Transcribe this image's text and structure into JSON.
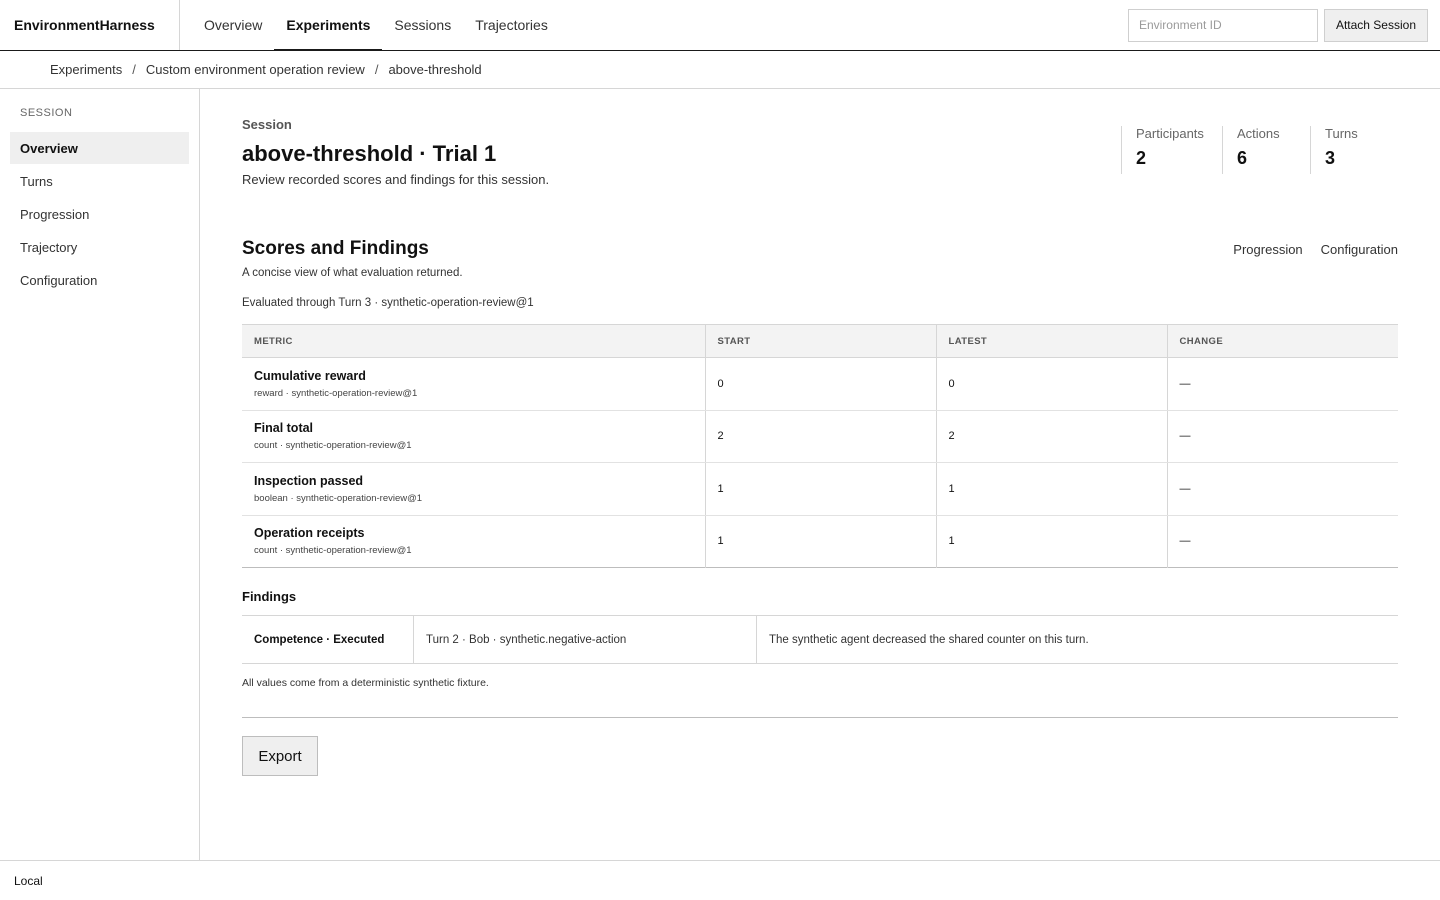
{
  "app": {
    "brand": "EnvironmentHarness"
  },
  "topnav": {
    "items": [
      {
        "label": "Overview"
      },
      {
        "label": "Experiments",
        "active": true
      },
      {
        "label": "Sessions"
      },
      {
        "label": "Trajectories"
      }
    ],
    "environment_placeholder": "Environment ID",
    "attach_label": "Attach Session"
  },
  "breadcrumb": {
    "items": [
      "Experiments",
      "Custom environment operation review",
      "above-threshold"
    ],
    "separator": "/"
  },
  "sidebar": {
    "heading": "SESSION",
    "items": [
      {
        "label": "Overview",
        "active": true
      },
      {
        "label": "Turns"
      },
      {
        "label": "Progression"
      },
      {
        "label": "Trajectory"
      },
      {
        "label": "Configuration"
      }
    ]
  },
  "session": {
    "label": "Session",
    "title": "above-threshold · Trial 1",
    "description": "Review recorded scores and findings for this session.",
    "stats": [
      {
        "label": "Participants",
        "value": "2"
      },
      {
        "label": "Actions",
        "value": "6"
      },
      {
        "label": "Turns",
        "value": "3"
      }
    ]
  },
  "scores": {
    "title": "Scores and Findings",
    "description": "A concise view of what evaluation returned.",
    "links": [
      "Progression",
      "Configuration"
    ],
    "evaluated_note": "Evaluated through Turn 3 · synthetic-operation-review@1",
    "columns": [
      "METRIC",
      "START",
      "LATEST",
      "CHANGE"
    ],
    "rows": [
      {
        "name": "Cumulative reward",
        "sub": "reward · synthetic-operation-review@1",
        "start": "0",
        "latest": "0",
        "change": "—"
      },
      {
        "name": "Final total",
        "sub": "count · synthetic-operation-review@1",
        "start": "2",
        "latest": "2",
        "change": "—"
      },
      {
        "name": "Inspection passed",
        "sub": "boolean · synthetic-operation-review@1",
        "start": "1",
        "latest": "1",
        "change": "—"
      },
      {
        "name": "Operation receipts",
        "sub": "count · synthetic-operation-review@1",
        "start": "1",
        "latest": "1",
        "change": "—"
      }
    ]
  },
  "findings": {
    "title": "Findings",
    "items": [
      {
        "kind": "Competence · Executed",
        "source": "Turn 2 · Bob · synthetic.negative-action",
        "text": "The synthetic agent decreased the shared counter on this turn."
      }
    ],
    "note": "All values come from a deterministic synthetic fixture."
  },
  "actions": {
    "export_label": "Export"
  },
  "footer": {
    "label": "Local"
  }
}
